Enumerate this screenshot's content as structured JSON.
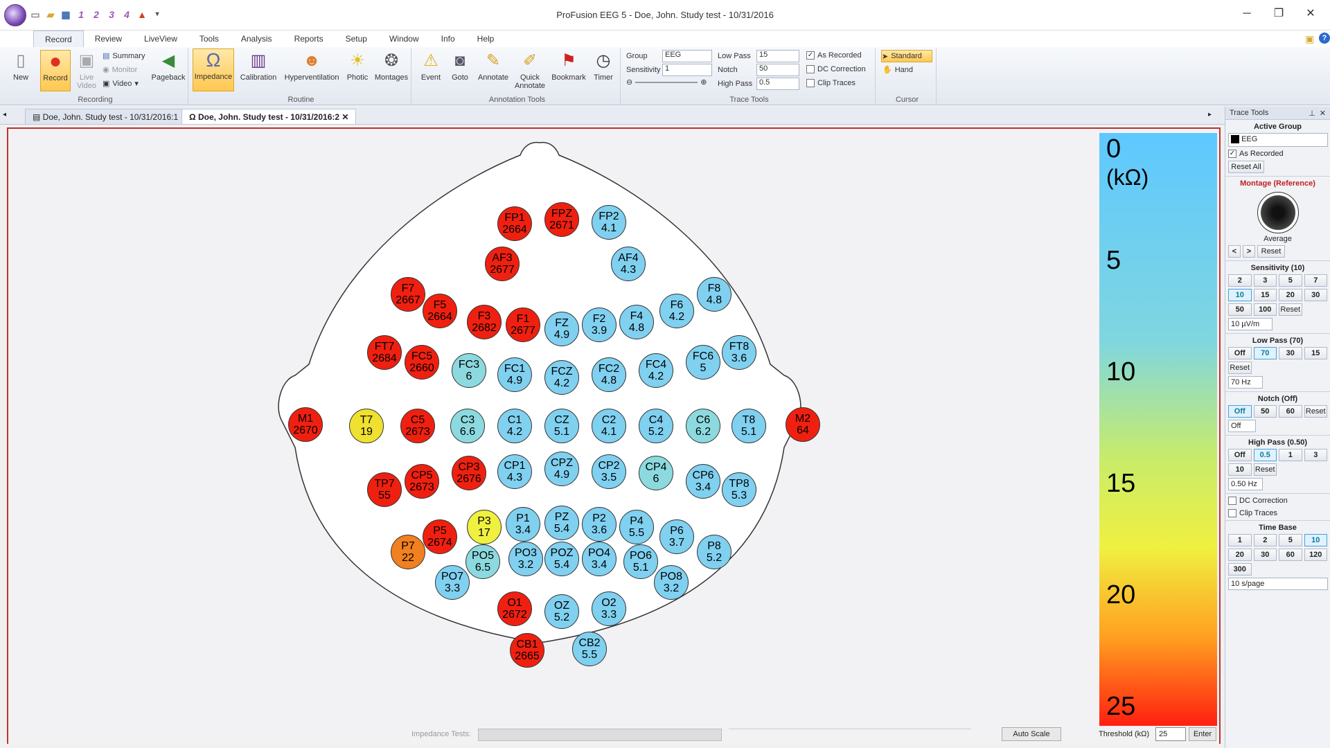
{
  "window": {
    "title": "ProFusion EEG 5 - Doe, John. Study test - 10/31/2016"
  },
  "qat": [
    "1",
    "2",
    "3",
    "4"
  ],
  "ribbon_tabs": [
    "Record",
    "Review",
    "LiveView",
    "Tools",
    "Analysis",
    "Reports",
    "Setup",
    "Window",
    "Info",
    "Help"
  ],
  "ribbon": {
    "recording": {
      "label": "Recording",
      "new": "New",
      "record": "Record",
      "live_video": "Live Video",
      "summary": "Summary",
      "monitor": "Monitor",
      "video": "Video",
      "pageback": "Pageback"
    },
    "routine": {
      "label": "Routine",
      "impedance": "Impedance",
      "calibration": "Calibration",
      "hyperventilation": "Hyperventilation",
      "photic": "Photic",
      "montages": "Montages"
    },
    "annotation": {
      "label": "Annotation Tools",
      "event": "Event",
      "goto": "Goto",
      "annotate": "Annotate",
      "quick_annotate": "Quick Annotate",
      "bookmark": "Bookmark",
      "timer": "Timer"
    },
    "trace": {
      "label": "Trace Tools",
      "group_label": "Group",
      "group_value": "EEG",
      "sensitivity_label": "Sensitivity",
      "sensitivity_value": "1",
      "lowpass_label": "Low Pass",
      "lowpass_value": "15",
      "notch_label": "Notch",
      "notch_value": "50",
      "highpass_label": "High Pass",
      "highpass_value": "0.5",
      "as_recorded": "As Recorded",
      "dc_correction": "DC Correction",
      "clip_traces": "Clip Traces"
    },
    "cursor": {
      "label": "Cursor",
      "standard": "Standard",
      "hand": "Hand"
    }
  },
  "doc_tabs": [
    "Doe, John. Study test - 10/31/2016:1",
    "Doe, John. Study test - 10/31/2016:2"
  ],
  "electrodes": [
    {
      "name": "FP1",
      "value": "2664",
      "color": "#f02010"
    },
    {
      "name": "FPZ",
      "value": "2671",
      "color": "#f02010"
    },
    {
      "name": "FP2",
      "value": "4.1",
      "color": "#80d0f0"
    },
    {
      "name": "AF3",
      "value": "2677",
      "color": "#f02010"
    },
    {
      "name": "AF4",
      "value": "4.3",
      "color": "#80d0f0"
    },
    {
      "name": "F7",
      "value": "2667",
      "color": "#f02010"
    },
    {
      "name": "F5",
      "value": "2664",
      "color": "#f02010"
    },
    {
      "name": "F3",
      "value": "2682",
      "color": "#f02010"
    },
    {
      "name": "F1",
      "value": "2677",
      "color": "#f02010"
    },
    {
      "name": "FZ",
      "value": "4.9",
      "color": "#80d0f0"
    },
    {
      "name": "F2",
      "value": "3.9",
      "color": "#80d0f0"
    },
    {
      "name": "F4",
      "value": "4.8",
      "color": "#80d0f0"
    },
    {
      "name": "F6",
      "value": "4.2",
      "color": "#80d0f0"
    },
    {
      "name": "F8",
      "value": "4.8",
      "color": "#80d0f0"
    },
    {
      "name": "FT7",
      "value": "2684",
      "color": "#f02010"
    },
    {
      "name": "FC5",
      "value": "2660",
      "color": "#f02010"
    },
    {
      "name": "FC3",
      "value": "6",
      "color": "#8cdae0"
    },
    {
      "name": "FC1",
      "value": "4.9",
      "color": "#80d0f0"
    },
    {
      "name": "FCZ",
      "value": "4.2",
      "color": "#80d0f0"
    },
    {
      "name": "FC2",
      "value": "4.8",
      "color": "#80d0f0"
    },
    {
      "name": "FC4",
      "value": "4.2",
      "color": "#80d0f0"
    },
    {
      "name": "FC6",
      "value": "5",
      "color": "#80d0f0"
    },
    {
      "name": "FT8",
      "value": "3.6",
      "color": "#80d0f0"
    },
    {
      "name": "M1",
      "value": "2670",
      "color": "#f02010"
    },
    {
      "name": "T7",
      "value": "19",
      "color": "#f0e030"
    },
    {
      "name": "C5",
      "value": "2673",
      "color": "#f02010"
    },
    {
      "name": "C3",
      "value": "6.6",
      "color": "#8cdae0"
    },
    {
      "name": "C1",
      "value": "4.2",
      "color": "#80d0f0"
    },
    {
      "name": "CZ",
      "value": "5.1",
      "color": "#80d0f0"
    },
    {
      "name": "C2",
      "value": "4.1",
      "color": "#80d0f0"
    },
    {
      "name": "C4",
      "value": "5.2",
      "color": "#80d0f0"
    },
    {
      "name": "C6",
      "value": "6.2",
      "color": "#8cdae0"
    },
    {
      "name": "T8",
      "value": "5.1",
      "color": "#80d0f0"
    },
    {
      "name": "M2",
      "value": "64",
      "color": "#f02010"
    },
    {
      "name": "TP7",
      "value": "55",
      "color": "#f02010"
    },
    {
      "name": "CP5",
      "value": "2673",
      "color": "#f02010"
    },
    {
      "name": "CP3",
      "value": "2676",
      "color": "#f02010"
    },
    {
      "name": "CP1",
      "value": "4.3",
      "color": "#80d0f0"
    },
    {
      "name": "CPZ",
      "value": "4.9",
      "color": "#80d0f0"
    },
    {
      "name": "CP2",
      "value": "3.5",
      "color": "#80d0f0"
    },
    {
      "name": "CP4",
      "value": "6",
      "color": "#8cdae0"
    },
    {
      "name": "CP6",
      "value": "3.4",
      "color": "#80d0f0"
    },
    {
      "name": "TP8",
      "value": "5.3",
      "color": "#80d0f0"
    },
    {
      "name": "P3",
      "value": "17",
      "color": "#f0f040"
    },
    {
      "name": "P1",
      "value": "3.4",
      "color": "#80d0f0"
    },
    {
      "name": "PZ",
      "value": "5.4",
      "color": "#80d0f0"
    },
    {
      "name": "P2",
      "value": "3.6",
      "color": "#80d0f0"
    },
    {
      "name": "P4",
      "value": "5.5",
      "color": "#80d0f0"
    },
    {
      "name": "P5",
      "value": "2674",
      "color": "#f02010"
    },
    {
      "name": "P6",
      "value": "3.7",
      "color": "#80d0f0"
    },
    {
      "name": "P7",
      "value": "22",
      "color": "#f08020"
    },
    {
      "name": "P8",
      "value": "5.2",
      "color": "#80d0f0"
    },
    {
      "name": "PO5",
      "value": "6.5",
      "color": "#8cdae0"
    },
    {
      "name": "PO3",
      "value": "3.2",
      "color": "#80d0f0"
    },
    {
      "name": "POZ",
      "value": "5.4",
      "color": "#80d0f0"
    },
    {
      "name": "PO4",
      "value": "3.4",
      "color": "#80d0f0"
    },
    {
      "name": "PO6",
      "value": "5.1",
      "color": "#80d0f0"
    },
    {
      "name": "PO7",
      "value": "3.3",
      "color": "#80d0f0"
    },
    {
      "name": "PO8",
      "value": "3.2",
      "color": "#80d0f0"
    },
    {
      "name": "O1",
      "value": "2672",
      "color": "#f02010"
    },
    {
      "name": "OZ",
      "value": "5.2",
      "color": "#80d0f0"
    },
    {
      "name": "O2",
      "value": "3.3",
      "color": "#80d0f0"
    },
    {
      "name": "CB1",
      "value": "2665",
      "color": "#f02010"
    },
    {
      "name": "CB2",
      "value": "5.5",
      "color": "#80d0f0"
    }
  ],
  "colorbar": {
    "unit": "(kΩ)",
    "labels": [
      "0",
      "5",
      "10",
      "15",
      "20",
      "25"
    ]
  },
  "bottom": {
    "impedance_tests_label": "Impedance Tests:",
    "auto_scale": "Auto Scale",
    "threshold_label": "Threshold (kΩ)",
    "threshold_value": "25",
    "enter": "Enter"
  },
  "side": {
    "title": "Trace Tools",
    "active_group_label": "Active Group",
    "active_group_value": "EEG",
    "as_recorded": "As Recorded",
    "reset_all": "Reset All",
    "montage_label": "Montage (Reference)",
    "montage_name": "Average",
    "prev": "<",
    "next": ">",
    "reset": "Reset",
    "sensitivity_label": "Sensitivity (10)",
    "sensitivity_opts": [
      "2",
      "3",
      "5",
      "7",
      "10",
      "15",
      "20",
      "30",
      "50",
      "100"
    ],
    "sensitivity_value": "10 µV/m",
    "lowpass_label": "Low Pass (70)",
    "lowpass_opts": [
      "Off",
      "70",
      "30",
      "15"
    ],
    "lowpass_value": "70 Hz",
    "notch_label": "Notch (Off)",
    "notch_opts": [
      "Off",
      "50",
      "60"
    ],
    "notch_value": "Off",
    "highpass_label": "High Pass (0.50)",
    "highpass_opts": [
      "Off",
      "0.5",
      "1",
      "3",
      "10"
    ],
    "highpass_value": "0.50 Hz",
    "dc_correction": "DC Correction",
    "clip_traces": "Clip Traces",
    "timebase_label": "Time Base",
    "timebase_opts": [
      "1",
      "2",
      "5",
      "10",
      "20",
      "30",
      "60",
      "120",
      "300"
    ],
    "timebase_value": "10 s/page"
  }
}
